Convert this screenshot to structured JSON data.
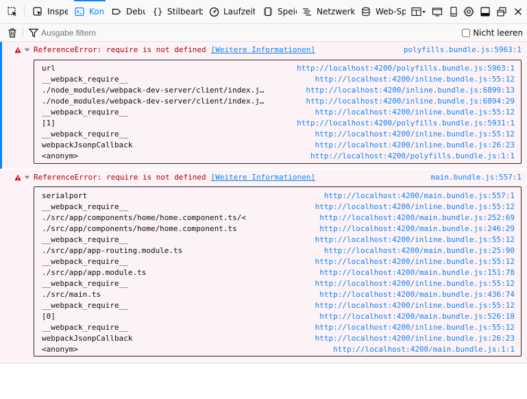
{
  "toolbar": {
    "tabs": [
      {
        "icon": "inspector-icon",
        "label": "Inspe"
      },
      {
        "icon": "console-icon",
        "label": "Kon"
      },
      {
        "icon": "debugger-icon",
        "label": "Debu"
      },
      {
        "icon": "style-editor-icon",
        "label": "Stilbearbe"
      },
      {
        "icon": "performance-icon",
        "label": "Laufzeita"
      },
      {
        "icon": "memory-icon",
        "label": "Speic"
      },
      {
        "icon": "network-icon",
        "label": "Netzwerka"
      },
      {
        "icon": "storage-icon",
        "label": "Web-Spe"
      }
    ],
    "buttons": [
      "dock-layout-icon",
      "responsive-mode-icon",
      "mobile-icon",
      "settings-gear-icon",
      "dock-side-icon",
      "undock-window-icon",
      "close-icon"
    ]
  },
  "filterbar": {
    "placeholder": "Ausgabe filtern",
    "persist_label": "Nicht leeren"
  },
  "messages": [
    {
      "text": "ReferenceError: require is not defined",
      "learn_more": "[Weitere Informationen]",
      "location": "polyfills.bundle.js:5963:1",
      "frames": [
        {
          "fn": "url",
          "loc": "http://localhost:4200/polyfills.bundle.js:5963:1"
        },
        {
          "fn": "__webpack_require__",
          "loc": "http://localhost:4200/inline.bundle.js:55:12"
        },
        {
          "fn": "./node_modules/webpack-dev-server/client/index.j…",
          "loc": "http://localhost:4200/inline.bundle.js:6899:13"
        },
        {
          "fn": "./node_modules/webpack-dev-server/client/index.j…",
          "loc": "http://localhost:4200/inline.bundle.js:6894:29"
        },
        {
          "fn": "__webpack_require__",
          "loc": "http://localhost:4200/inline.bundle.js:55:12"
        },
        {
          "fn": "[1]",
          "loc": "http://localhost:4200/polyfills.bundle.js:5931:1"
        },
        {
          "fn": "__webpack_require__",
          "loc": "http://localhost:4200/inline.bundle.js:55:12"
        },
        {
          "fn": "webpackJsonpCallback",
          "loc": "http://localhost:4200/inline.bundle.js:26:23"
        },
        {
          "fn": "<anonym>",
          "loc": "http://localhost:4200/polyfills.bundle.js:1:1"
        }
      ]
    },
    {
      "text": "ReferenceError: require is not defined",
      "learn_more": "[Weitere Informationen]",
      "location": "main.bundle.js:557:1",
      "frames": [
        {
          "fn": "serialport",
          "loc": "http://localhost:4200/main.bundle.js:557:1"
        },
        {
          "fn": "__webpack_require__",
          "loc": "http://localhost:4200/inline.bundle.js:55:12"
        },
        {
          "fn": "./src/app/components/home/home.component.ts/<",
          "loc": "http://localhost:4200/main.bundle.js:252:69"
        },
        {
          "fn": "./src/app/components/home/home.component.ts",
          "loc": "http://localhost:4200/main.bundle.js:246:29"
        },
        {
          "fn": "__webpack_require__",
          "loc": "http://localhost:4200/inline.bundle.js:55:12"
        },
        {
          "fn": "./src/app/app-routing.module.ts",
          "loc": "http://localhost:4200/main.bundle.js:25:90"
        },
        {
          "fn": "__webpack_require__",
          "loc": "http://localhost:4200/inline.bundle.js:55:12"
        },
        {
          "fn": "./src/app/app.module.ts",
          "loc": "http://localhost:4200/main.bundle.js:151:78"
        },
        {
          "fn": "__webpack_require__",
          "loc": "http://localhost:4200/inline.bundle.js:55:12"
        },
        {
          "fn": "./src/main.ts",
          "loc": "http://localhost:4200/main.bundle.js:436:74"
        },
        {
          "fn": "__webpack_require__",
          "loc": "http://localhost:4200/inline.bundle.js:55:12"
        },
        {
          "fn": "[0]",
          "loc": "http://localhost:4200/main.bundle.js:526:18"
        },
        {
          "fn": "__webpack_require__",
          "loc": "http://localhost:4200/inline.bundle.js:55:12"
        },
        {
          "fn": "webpackJsonpCallback",
          "loc": "http://localhost:4200/inline.bundle.js:26:23"
        },
        {
          "fn": "<anonym>",
          "loc": "http://localhost:4200/main.bundle.js:1:1"
        }
      ]
    }
  ],
  "colors": {
    "accent": "#0a84ff",
    "error_text": "#a4000f",
    "error_bg": "#fdf2f5",
    "error_icon": "#d70022"
  }
}
